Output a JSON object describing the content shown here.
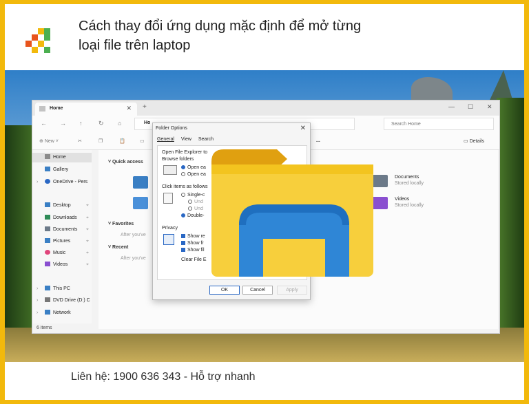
{
  "headline": {
    "line1": "Cách thay đổi ứng dụng mặc định để mở từng",
    "line2": "loại file trên laptop"
  },
  "footer": {
    "contact": "Liên hệ: 1900 636 343 - Hỗ trợ nhanh"
  },
  "colors": {
    "border": "#f2b90c",
    "accent": "#2a68c4"
  },
  "explorer": {
    "tab_title": "Home",
    "breadcrumb": "Ho",
    "search_placeholder": "Search Home",
    "new_label": "New",
    "details_label": "Details",
    "more_label": "...",
    "sidebar": [
      {
        "label": "Home",
        "icon": "home-icon"
      },
      {
        "label": "Gallery",
        "icon": "gallery-icon"
      },
      {
        "label": "OneDrive - Pers",
        "icon": "cloud-icon"
      },
      {
        "label": "Desktop",
        "icon": "desktop-icon"
      },
      {
        "label": "Downloads",
        "icon": "download-icon"
      },
      {
        "label": "Documents",
        "icon": "documents-icon"
      },
      {
        "label": "Pictures",
        "icon": "pictures-icon"
      },
      {
        "label": "Music",
        "icon": "music-icon"
      },
      {
        "label": "Videos",
        "icon": "videos-icon"
      },
      {
        "label": "This PC",
        "icon": "pc-icon"
      },
      {
        "label": "DVD Drive (D:) C",
        "icon": "dvd-icon"
      },
      {
        "label": "Network",
        "icon": "network-icon"
      }
    ],
    "status": "6 items",
    "sections": {
      "quick_access": "Quick access",
      "favorites": "Favorites",
      "favorites_sub": "After you've",
      "recent": "Recent",
      "recent_sub": "After you've"
    },
    "libraries": [
      {
        "name": "Documents",
        "status": "Stored locally"
      },
      {
        "name": "Videos",
        "status": "Stored locally"
      }
    ]
  },
  "dialog": {
    "title": "Folder Options",
    "tabs": [
      "General",
      "View",
      "Search"
    ],
    "open_to_label": "Open File Explorer to",
    "browse_group": "Browse folders",
    "browse_opt1": "Open ea",
    "browse_opt2": "Open ea",
    "click_group": "Click items as follows",
    "click_opt1": "Single-c",
    "click_opt1a": "Und",
    "click_opt1b": "Und",
    "click_opt2": "Double-",
    "privacy_group": "Privacy",
    "privacy_opt1": "Show re",
    "privacy_opt2": "Show fr",
    "privacy_opt3": "Show fil",
    "clear_label": "Clear File E",
    "ok_label": "OK",
    "cancel_label": "Cancel",
    "apply_label": "Apply"
  }
}
